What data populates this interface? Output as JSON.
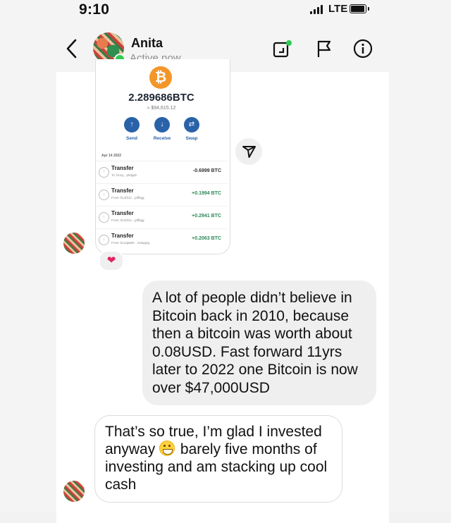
{
  "status_bar": {
    "time": "9:10",
    "network": "LTE"
  },
  "header": {
    "contact_name": "Anita",
    "contact_status": "Active now",
    "icons": [
      "back-chevron-icon",
      "video-call-icon",
      "flag-icon",
      "info-icon"
    ],
    "online_color": "#2ecc52"
  },
  "shared_image": {
    "coin_symbol": "₿",
    "balance": "2.289686BTC",
    "fiat_value": "≈ $94,615.12",
    "actions": [
      "Send",
      "Receive",
      "Swap"
    ],
    "date": "Apr 14 2022",
    "transactions": [
      {
        "title": "Transfer",
        "sub": "To: bc1q…plrdgdz",
        "amount": "-0.6999 BTC"
      },
      {
        "title": "Transfer",
        "sub": "From: bc1f31z…jalfhgg",
        "amount": "+0.1994 BTC"
      },
      {
        "title": "Transfer",
        "sub": "From: bc1f31z…jalfhgg",
        "amount": "+0.2941 BTC"
      },
      {
        "title": "Transfer",
        "sub": "From: bc1qMaR…1v0qq2g",
        "amount": "+0.2063 BTC"
      }
    ],
    "accent": "#2962a8",
    "positive_color": "#2d8a5a"
  },
  "reaction": "❤",
  "messages": {
    "outgoing": "A lot of people didn’t believe in Bitcoin back in 2010, because then a bitcoin was worth about 0.08USD. Fast forward 11yrs later to 2022 one Bitcoin is now over $47,000USD",
    "incoming_part1": "That’s so true, I’m glad I invested anyway",
    "incoming_emoji": "grinning-face-emoji",
    "incoming_part2": "barely five months of investing and am stacking up cool cash"
  }
}
